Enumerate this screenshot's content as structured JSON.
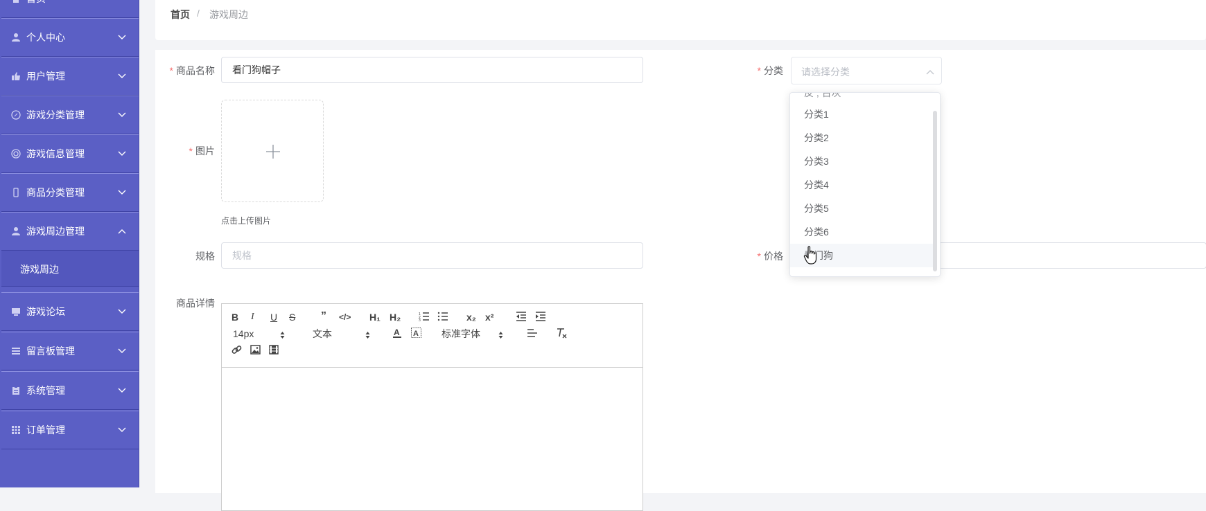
{
  "sidebar": {
    "items": [
      {
        "label": "首页",
        "icon": "home-icon"
      },
      {
        "label": "个人中心",
        "icon": "user-icon"
      },
      {
        "label": "用户管理",
        "icon": "thumb-icon"
      },
      {
        "label": "游戏分类管理",
        "icon": "compass-icon"
      },
      {
        "label": "游戏信息管理",
        "icon": "help-circle-icon"
      },
      {
        "label": "商品分类管理",
        "icon": "phone-icon"
      },
      {
        "label": "游戏周边管理",
        "icon": "user-icon"
      },
      {
        "label": "游戏论坛",
        "icon": "monitor-icon"
      },
      {
        "label": "留言板管理",
        "icon": "list-icon"
      },
      {
        "label": "系统管理",
        "icon": "clipboard-icon"
      },
      {
        "label": "订单管理",
        "icon": "grid-icon"
      }
    ],
    "sub_item": "游戏周边"
  },
  "breadcrumb": {
    "home": "首页",
    "separator": "/",
    "current": "游戏周边"
  },
  "form": {
    "name_label": "商品名称",
    "name_value": "看门狗帽子",
    "category_label": "分类",
    "category_placeholder": "请选择分类",
    "image_label": "图片",
    "upload_hint": "点击上传图片",
    "spec_label": "规格",
    "spec_placeholder": "规格",
    "price_label": "价格",
    "detail_label": "商品详情"
  },
  "editor_toolbar": {
    "font_size": "14px",
    "text_type": "文本",
    "font_family": "标准字体",
    "h1": "H₁",
    "h2": "H₂",
    "sub": "x₂",
    "sup": "x²"
  },
  "dropdown": {
    "partial_item": "反 , 台灰",
    "options": [
      "分类1",
      "分类2",
      "分类3",
      "分类4",
      "分类5",
      "分类6",
      "看门狗"
    ],
    "hovered_index": 6
  },
  "colors": {
    "sidebar_bg": "#5b5fc5",
    "required": "#f56c6c",
    "page_bg": "#f3f4f7"
  }
}
